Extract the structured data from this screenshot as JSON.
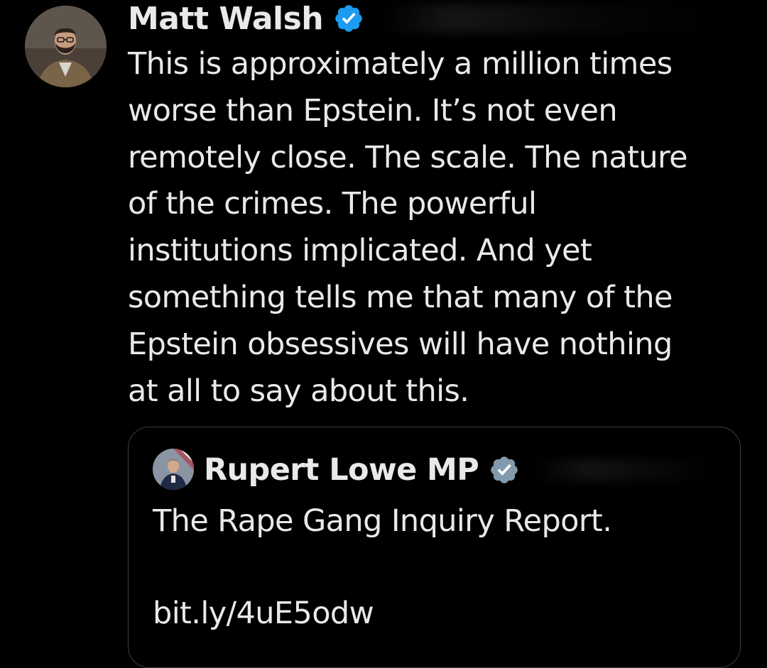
{
  "tweet": {
    "author_name": "Matt Walsh",
    "verified_icon": "verified-badge-icon",
    "text": "This is approximately a million times\nworse than Epstein. It’s not even\nremotely close. The scale. The nature\nof the crimes. The powerful\ninstitutions implicated. And yet\nsomething tells me that many of the\nEpstein obsessives will have nothing\nat all to say about this."
  },
  "quoted_tweet": {
    "author_name": "Rupert Lowe MP",
    "verified_icon": "verified-badge-gray-icon",
    "text": "The Rape Gang Inquiry Report.",
    "link": "bit.ly/4uE5odw"
  },
  "colors": {
    "background": "#000000",
    "text": "#e7e9ea",
    "verified_blue": "#1d9bf0",
    "verified_gray": "#829aab",
    "border": "#3a3d40"
  }
}
